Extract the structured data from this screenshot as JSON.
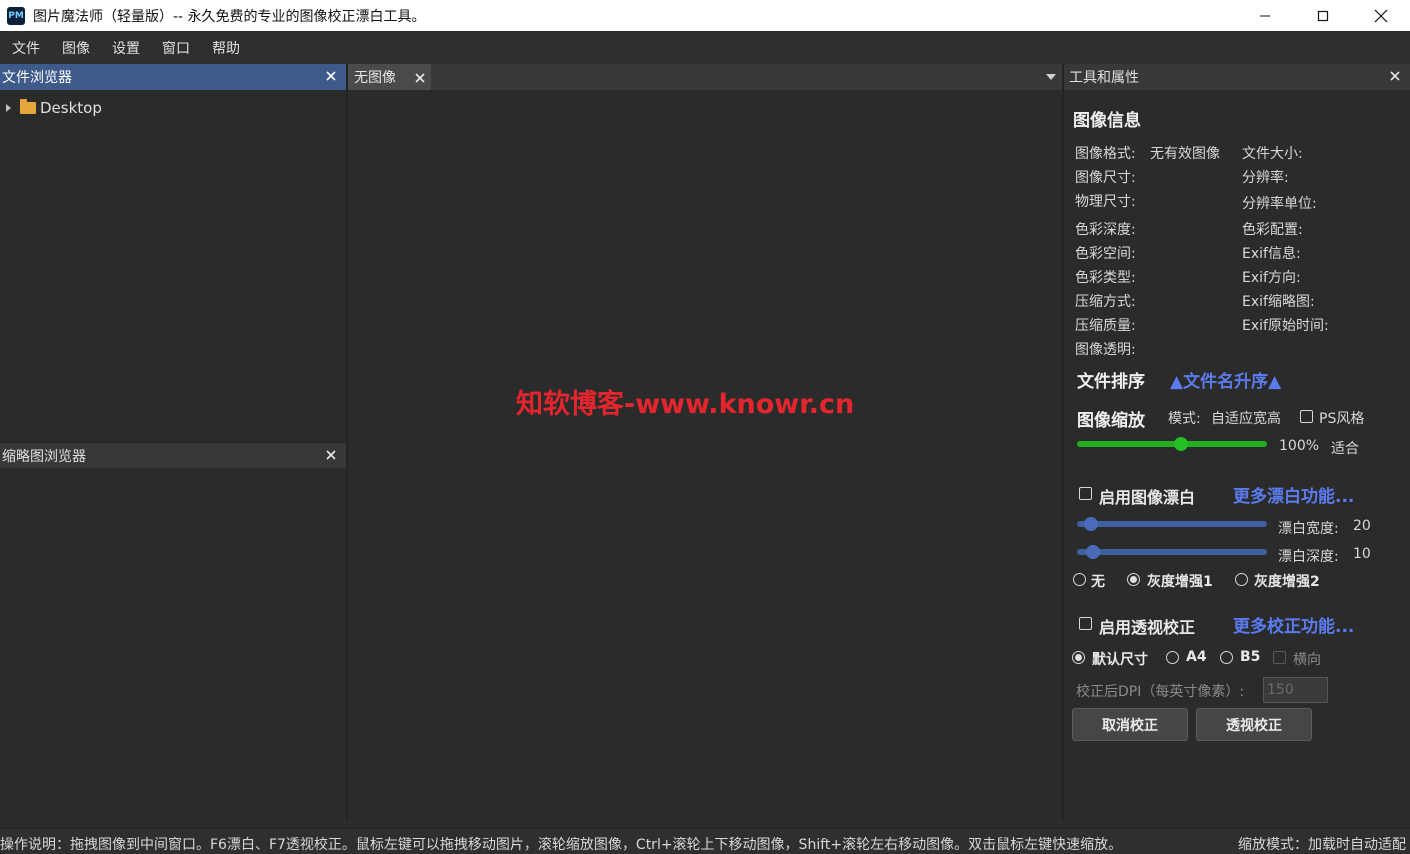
{
  "window": {
    "title": "图片魔法师（轻量版）--  永久免费的专业的图像校正漂白工具。",
    "icon_text": "PM",
    "minimize_icon": "minimize-icon",
    "maximize_icon": "maximize-icon",
    "close_icon": "close-icon"
  },
  "menu": [
    "文件",
    "图像",
    "设置",
    "窗口",
    "帮助"
  ],
  "file_browser": {
    "title": "文件浏览器",
    "tree": [
      {
        "label": "Desktop",
        "icon": "folder-icon"
      }
    ]
  },
  "thumb_browser": {
    "title": "缩略图浏览器"
  },
  "document": {
    "tab_label": "无图像",
    "watermark": "知软博客-www.knowr.cn"
  },
  "tools": {
    "title": "工具和属性",
    "image_info": {
      "title": "图像信息",
      "left": [
        {
          "label": "图像格式:",
          "value": "无有效图像"
        },
        {
          "label": "图像尺寸:",
          "value": ""
        },
        {
          "label": "物理尺寸:",
          "value": ""
        },
        {
          "label": "色彩深度:",
          "value": ""
        },
        {
          "label": "色彩空间:",
          "value": ""
        },
        {
          "label": "色彩类型:",
          "value": ""
        },
        {
          "label": "压缩方式:",
          "value": ""
        },
        {
          "label": "压缩质量:",
          "value": ""
        },
        {
          "label": "图像透明:",
          "value": ""
        }
      ],
      "right": [
        {
          "label": "文件大小:",
          "value": ""
        },
        {
          "label": "分辨率:",
          "value": ""
        },
        {
          "label": "分辨率单位:",
          "value": ""
        },
        {
          "label": "色彩配置:",
          "value": ""
        },
        {
          "label": "Exif信息:",
          "value": ""
        },
        {
          "label": "Exif方向:",
          "value": ""
        },
        {
          "label": "Exif缩略图:",
          "value": ""
        },
        {
          "label": "Exif原始时间:",
          "value": ""
        }
      ]
    },
    "sort": {
      "title": "文件排序",
      "value": "▲文件名升序▲"
    },
    "zoom": {
      "title": "图像缩放",
      "mode_label": "模式:",
      "mode_value": "自适应宽高",
      "ps_style_label": "PS风格",
      "ps_style_checked": false,
      "percent": "100%",
      "fit_label": "适合",
      "slider_fraction": 0.55,
      "color": "#22b022"
    },
    "whiten": {
      "enable_label": "启用图像漂白",
      "enabled": false,
      "more_link": "更多漂白功能...",
      "width_label": "漂白宽度:",
      "width_value": "20",
      "width_fraction": 0.04,
      "depth_label": "漂白深度:",
      "depth_value": "10",
      "depth_fraction": 0.05,
      "slider_color": "#3f5fa0",
      "modes": [
        {
          "label": "无",
          "selected": false
        },
        {
          "label": "灰度增强1",
          "selected": true
        },
        {
          "label": "灰度增强2",
          "selected": false
        }
      ]
    },
    "perspective": {
      "enable_label": "启用透视校正",
      "enabled": false,
      "more_link": "更多校正功能...",
      "sizes": [
        {
          "label": "默认尺寸",
          "selected": true
        },
        {
          "label": "A4",
          "selected": false
        },
        {
          "label": "B5",
          "selected": false
        }
      ],
      "landscape_label": "横向",
      "dpi_label": "校正后DPI（每英寸像素）:",
      "dpi_value": "150",
      "cancel_button": "取消校正",
      "apply_button": "透视校正"
    }
  },
  "status": {
    "help": "操作说明：拖拽图像到中间窗口。F6漂白、F7透视校正。鼠标左键可以拖拽移动图片，滚轮缩放图像，Ctrl+滚轮上下移动图像，Shift+滚轮左右移动图像。双击鼠标左键快速缩放。",
    "zoom_mode": "缩放模式：加载时自动适配"
  },
  "accent_colors": {
    "selected_header": "#3d5a8a",
    "link": "#5b7cf0",
    "watermark": "#e3262e"
  }
}
